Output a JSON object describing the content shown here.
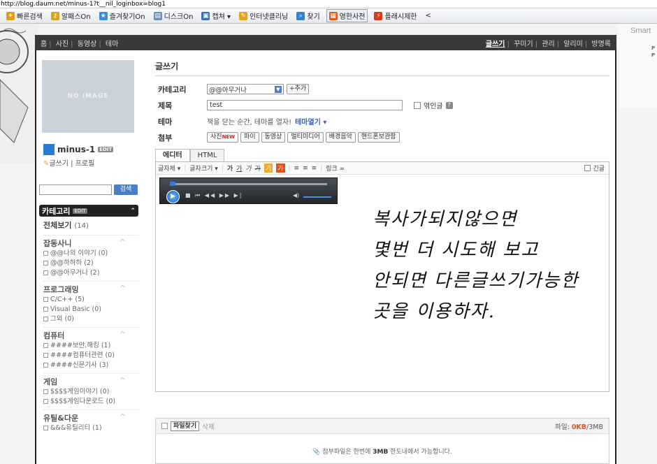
{
  "browser": {
    "url": "http://blog.daum.net/minus-1?t__nil_loginbox=blog1",
    "links": [
      {
        "label": "빠른검색",
        "icon": "bee-icon",
        "color": "#e49b18"
      },
      {
        "label": "알패스On",
        "icon": "key-icon",
        "color": "#d9a21b"
      },
      {
        "label": "즐겨찾기On",
        "icon": "star-icon",
        "color": "#3b8bd8"
      },
      {
        "label": "디스크On",
        "icon": "disk-icon",
        "color": "#6a8fb8"
      },
      {
        "label": "캡쳐 ▾",
        "icon": "camera-icon",
        "color": "#3a6fb0"
      },
      {
        "label": "인터넷클리닝",
        "icon": "broom-icon",
        "color": "#e7a21b"
      },
      {
        "label": "찾기",
        "icon": "magnifier-icon",
        "color": "#3a7fd0"
      },
      {
        "label": "영한사전",
        "icon": "dictionary-icon",
        "color": "#e05a1b"
      },
      {
        "label": "플래시제한",
        "icon": "flash-block-icon",
        "color": "#d83b1b"
      },
      {
        "label": "<",
        "icon": "",
        "color": ""
      }
    ]
  },
  "topnav": {
    "left": [
      "홈",
      "사진",
      "동영상",
      "테마"
    ],
    "right": [
      "글쓰기",
      "꾸미기",
      "관리",
      "알리미",
      "방명록"
    ],
    "current": "글쓰기"
  },
  "deco": {
    "right_text": "Smart",
    "right_small": "P\nP"
  },
  "sidebar": {
    "profile_placeholder": "NO IMAGE",
    "nickname": "minus-1",
    "badge": "EDIT",
    "links": "글쓰기 | 프로필",
    "search_button": "검색",
    "category_title": "카테고리",
    "category_edit": "EDIT",
    "all_label": "전체보기",
    "all_count": "(14)",
    "groups": [
      {
        "title": "잡동사니",
        "items": [
          "@@나의 이야기 (0)",
          "@@하하하 (2)",
          "@@아무거나 (2)"
        ]
      },
      {
        "title": "프로그래밍",
        "items": [
          "C/C++ (5)",
          "Visual Basic (0)",
          "그외 (0)"
        ]
      },
      {
        "title": "컴퓨터",
        "items": [
          "####보안,해킹 (1)",
          "####컴퓨터관련 (0)",
          "####신문기사 (3)"
        ]
      },
      {
        "title": "게임",
        "items": [
          "$$$$게임이야기 (0)",
          "$$$$게임다운로드 (0)"
        ]
      },
      {
        "title": "유틸&다운",
        "items": [
          "&&&유틸리티 (1)"
        ]
      }
    ]
  },
  "editor": {
    "page_title": "글쓰기",
    "category_label": "카테고리",
    "category_value": "@@아무거나",
    "add_button": "+추가",
    "title_label": "제목",
    "title_value": "test",
    "secret_label": "엮인글",
    "theme_label": "테마",
    "theme_text": "책을 닫는 순간, 테마를 열자!",
    "theme_link": "테마열기",
    "attach_label": "첨부",
    "attach_buttons": [
      "사진",
      "파이",
      "동영상",
      "멀티미디어",
      "배경음악",
      "핸드폰보관함"
    ],
    "attach_new": "NEW",
    "tabs": [
      "에디터",
      "HTML"
    ],
    "toolbar": [
      "글자체 ▾",
      "글자크기 ▾",
      "가",
      "가",
      "가",
      "가",
      "가",
      "가",
      "≡",
      "≡",
      "≡",
      "링크"
    ],
    "urgent_label": "긴글",
    "handwriting": [
      "복사가되지않으면",
      "몇번 더 시도해 보고",
      "안되면 다른글쓰기가능한",
      "곳을 이용하자."
    ]
  },
  "upload": {
    "find_button": "파일찾기",
    "delete_label": "삭제",
    "size_prefix": "파일:",
    "size_value": "0KB",
    "size_limit": "/3MB",
    "note_prefix": "첨부파일은 한번에",
    "note_strong": "3MB",
    "note_suffix": "한도내에서 가능합니다."
  }
}
